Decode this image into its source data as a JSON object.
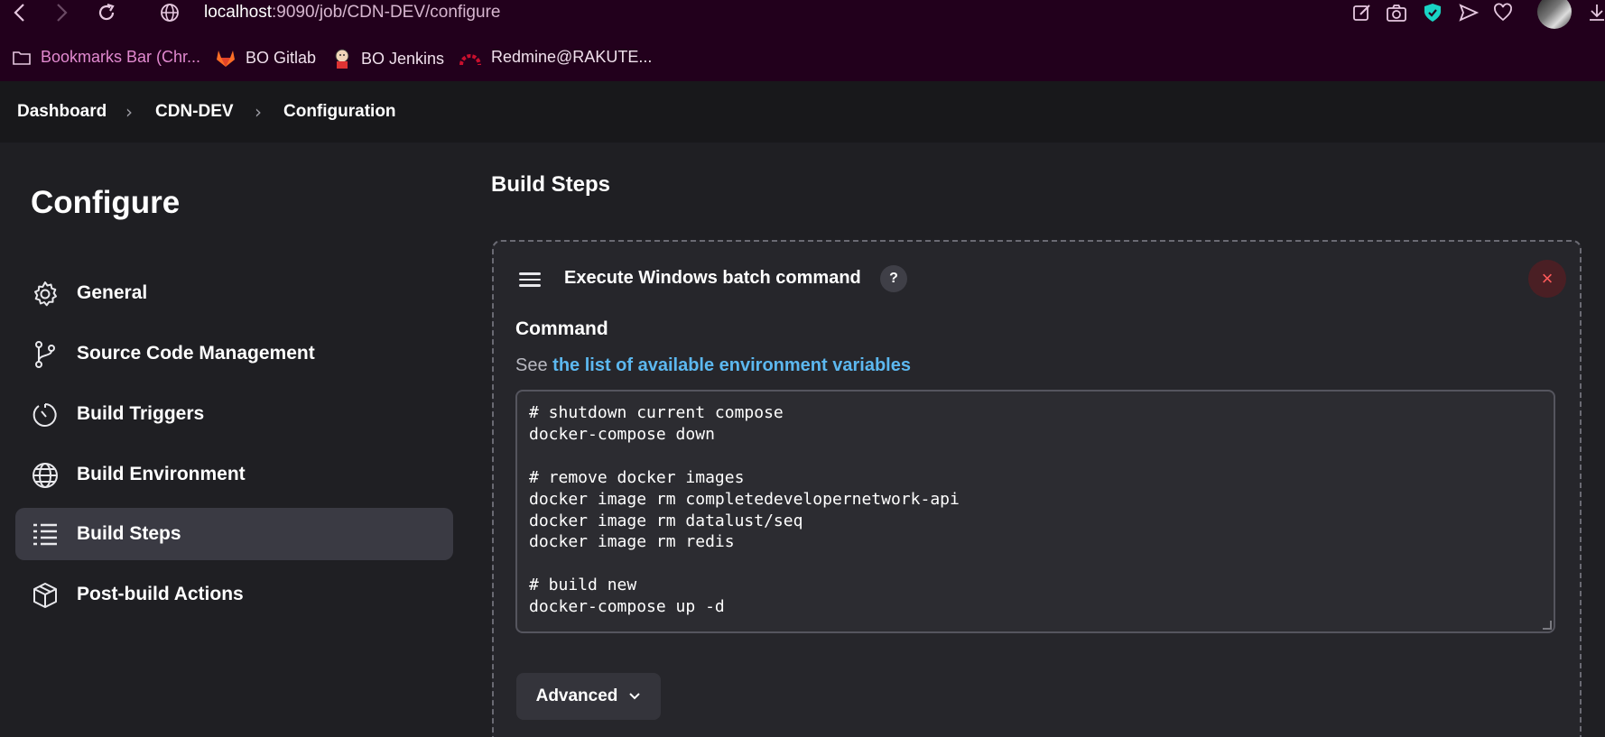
{
  "browser": {
    "url_host": "localhost",
    "url_rest": ":9090/job/CDN-DEV/configure",
    "bookmarks": [
      {
        "label": "Bookmarks Bar (Chr...",
        "icon": "folder-icon"
      },
      {
        "label": "BO Gitlab",
        "icon": "gitlab-icon"
      },
      {
        "label": "BO Jenkins",
        "icon": "jenkins-icon"
      },
      {
        "label": "Redmine@RAKUTE...",
        "icon": "redmine-icon"
      }
    ]
  },
  "breadcrumb": [
    "Dashboard",
    "CDN-DEV",
    "Configuration"
  ],
  "sidebar": {
    "title": "Configure",
    "items": [
      {
        "label": "General",
        "icon": "gear-icon",
        "active": false
      },
      {
        "label": "Source Code Management",
        "icon": "git-branch-icon",
        "active": false
      },
      {
        "label": "Build Triggers",
        "icon": "clock-icon",
        "active": false
      },
      {
        "label": "Build Environment",
        "icon": "globe-icon",
        "active": false
      },
      {
        "label": "Build Steps",
        "icon": "list-icon",
        "active": true
      },
      {
        "label": "Post-build Actions",
        "icon": "package-icon",
        "active": false
      }
    ]
  },
  "main": {
    "section_title": "Build Steps",
    "step": {
      "title": "Execute Windows batch command",
      "help": "?",
      "close": "×",
      "command_label": "Command",
      "see_prefix": "See",
      "see_link": "the list of available environment variables",
      "command_text": "# shutdown current compose\ndocker-compose down\n\n# remove docker images\ndocker image rm completedevelopernetwork-api\ndocker image rm datalust/seq\ndocker image rm redis\n\n# build new\ndocker-compose up -d",
      "advanced_label": "Advanced"
    }
  },
  "colors": {
    "browser_bg": "#22001c",
    "accent_link": "#5cb8f0",
    "active_item_bg": "#3a3a43"
  }
}
